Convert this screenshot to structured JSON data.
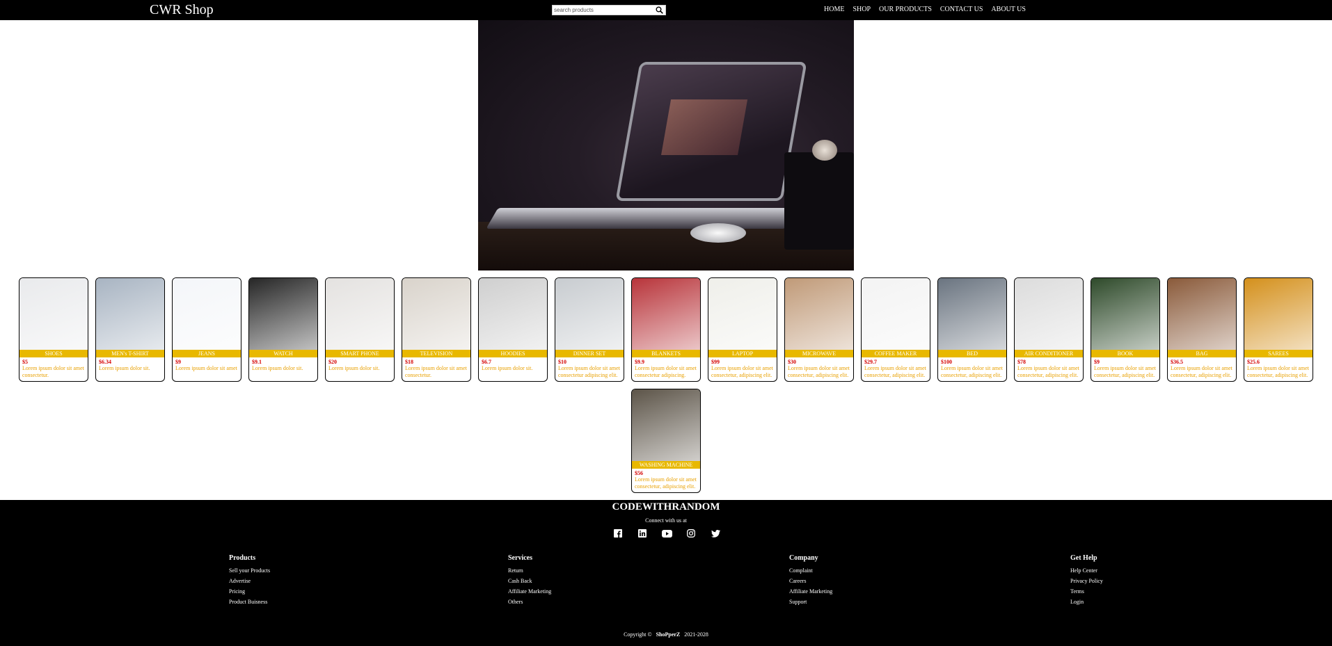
{
  "nav": {
    "brand": "CWR Shop",
    "search_placeholder": "search products",
    "search_icon": "search-icon",
    "menu": [
      "HOME",
      "SHOP",
      "OUR PRODUCTS",
      "CONTACT US",
      "ABOUT US"
    ]
  },
  "hero": {
    "image": "laptop-on-desk-photo"
  },
  "products": [
    {
      "name": "SHOES",
      "price": "$5",
      "desc": "Lorem ipsum dolor sit amet consectetur.",
      "color": "#e9eaec"
    },
    {
      "name": "MEN's T-SHIRT",
      "price": "$6.34",
      "desc": "Lorem ipsum dolor sit.",
      "color": "#a8b4c2"
    },
    {
      "name": "JEANS",
      "price": "$9",
      "desc": "Lorem ipsum dolor sit amet",
      "color": "#f4f6f9"
    },
    {
      "name": "WATCH",
      "price": "$9.1",
      "desc": "Lorem ipsum dolor sit.",
      "color": "#262626"
    },
    {
      "name": "SMART PHONE",
      "price": "$20",
      "desc": "Lorem ipsum dolor sit.",
      "color": "#e4e2e0"
    },
    {
      "name": "TELEVISION",
      "price": "$18",
      "desc": "Lorem ipsum dolor sit amet consectetur.",
      "color": "#d9d3cb"
    },
    {
      "name": "HOODIES",
      "price": "$6.7",
      "desc": "Lorem ipsum dolor sit.",
      "color": "#cfcfcf"
    },
    {
      "name": "DINNER SET",
      "price": "$10",
      "desc": "Lorem ipsum dolor sit amet consectetur adipiscing elit.",
      "color": "#c8ccd0"
    },
    {
      "name": "BLANKETS",
      "price": "$9.9",
      "desc": "Lorem ipsum dolor sit amet consectetur adipiscing.",
      "color": "#b8343a"
    },
    {
      "name": "LAPTOP",
      "price": "$99",
      "desc": "Lorem ipsum dolor sit amet consectetur, adipiscing elit.",
      "color": "#efefea"
    },
    {
      "name": "MICROWAVE",
      "price": "$30",
      "desc": "Lorem ipsum dolor sit amet consectetur, adipiscing elit.",
      "color": "#c09a78"
    },
    {
      "name": "COFFEE MAKER",
      "price": "$29.7",
      "desc": "Lorem ipsum dolor sit amet consectetur, adipiscing elit.",
      "color": "#f3f3f3"
    },
    {
      "name": "BED",
      "price": "$100",
      "desc": "Lorem ipsum dolor sit amet consectetur, adipiscing elit.",
      "color": "#6a7480"
    },
    {
      "name": "AIR CONDITIONER",
      "price": "$78",
      "desc": "Lorem ipsum dolor sit amet consectetur, adipiscing elit.",
      "color": "#dcdcdc"
    },
    {
      "name": "BOOK",
      "price": "$9",
      "desc": "Lorem ipsum dolor sit amet consectetur, adipiscing elit.",
      "color": "#2e4a2a"
    },
    {
      "name": "BAG",
      "price": "$36.5",
      "desc": "Lorem ipsum dolor sit amet consectetur, adipiscing elit.",
      "color": "#8a5a3a"
    },
    {
      "name": "SAREES",
      "price": "$25.6",
      "desc": "Lorem ipsum dolor sit amet consectetur, adipiscing elit.",
      "color": "#d4901c"
    },
    {
      "name": "WASHING MACHINE",
      "price": "$56",
      "desc": "Lorem ipsum dolor sit amet consectetur, adipiscing elit.",
      "color": "#5c5448"
    }
  ],
  "footer": {
    "title": "CODEWITHRANDOM",
    "connect": "Connect with us at",
    "socials": [
      "facebook-icon",
      "linkedin-icon",
      "youtube-icon",
      "instagram-icon",
      "twitter-icon"
    ],
    "columns": [
      {
        "heading": "Products",
        "links": [
          "Sell your Products",
          "Advertise",
          "Pricing",
          "Product Buisness"
        ]
      },
      {
        "heading": "Services",
        "links": [
          "Return",
          "Cash Back",
          "Affiliate Marketing",
          "Others"
        ]
      },
      {
        "heading": "Company",
        "links": [
          "Complaint",
          "Careers",
          "Affiliate Marketing",
          "Support"
        ]
      },
      {
        "heading": "Get Help",
        "links": [
          "Help Center",
          "Privacy Policy",
          "Terms",
          "Login"
        ]
      }
    ],
    "copyright_prefix": "Copyright ©",
    "copyright_brand": "ShoPperZ",
    "copyright_years": "2021-2028"
  }
}
